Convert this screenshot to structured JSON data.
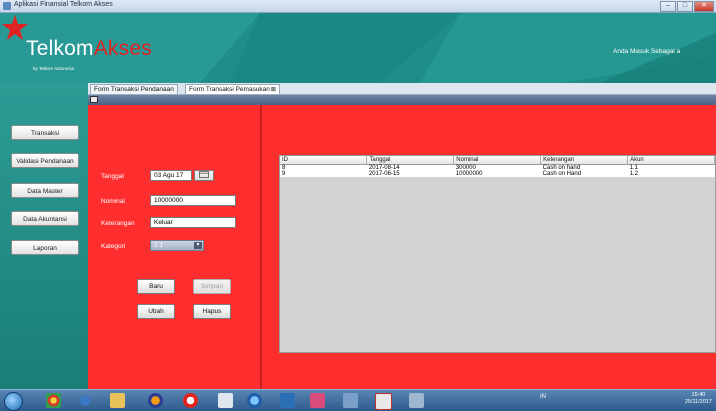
{
  "window": {
    "title": "Aplikasi Finansial Telkom Akses",
    "controls": {
      "minimize": "–",
      "maximize": "□",
      "close": "✕"
    }
  },
  "header": {
    "brand_part1": "Telkom",
    "brand_part2": "Akses",
    "subbrand": "by Telkom Indonesia",
    "user_message": "Anda Masuk Sebagai a"
  },
  "sidebar": {
    "items": [
      {
        "label": "Transaksi"
      },
      {
        "label": "Validasi Pendanaan"
      },
      {
        "label": "Data Master"
      },
      {
        "label": "Data Akuntansi"
      },
      {
        "label": "Laporan"
      }
    ]
  },
  "tabs": [
    {
      "label": "Form Transaksi Pendanaan",
      "active": false
    },
    {
      "label": "Form Transaksi Pemasukan",
      "active": true,
      "close": "⊠"
    }
  ],
  "form": {
    "tanggal_label": "Tanggal",
    "tanggal_value": "03 Agu 17",
    "calendar_icon": "calendar-icon",
    "nominal_label": "Nominal",
    "nominal_value": "10000000",
    "keterangan_label": "Keterangan",
    "keterangan_value": "Keluar",
    "kategori_label": "Kategori",
    "kategori_value": "1.1",
    "buttons": {
      "baru": "Baru",
      "simpan": "Simpan",
      "ubah": "Ubah",
      "hapus": "Hapus"
    }
  },
  "table": {
    "columns": [
      "ID",
      "Tanggal",
      "Nominal",
      "Keterangan",
      "Akun"
    ],
    "rows": [
      [
        "8",
        "2017-08-14",
        "300000",
        "Cash on hand",
        "1.1"
      ],
      [
        "9",
        "2017-06-15",
        "10000000",
        "Cash on Hand",
        "1.2"
      ]
    ]
  },
  "taskbar": {
    "clock_time": "15:40",
    "clock_date": "25/11/2017",
    "tray_lang": "IN"
  },
  "colors": {
    "header_bg": "#1f8e89",
    "panel_red": "#ff2e2e",
    "brand_red": "#e02424"
  }
}
